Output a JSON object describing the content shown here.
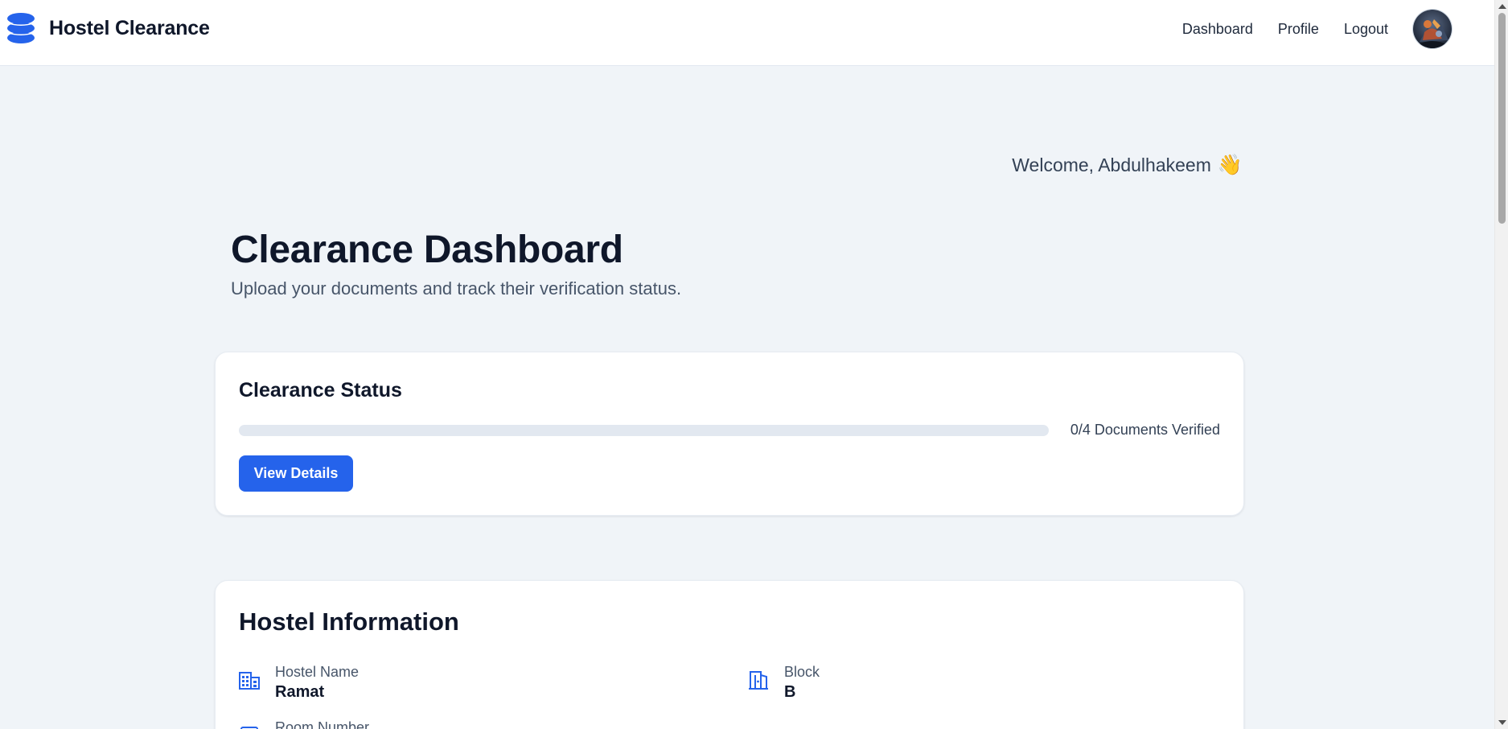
{
  "header": {
    "brand_title": "Hostel Clearance",
    "brand_icon": "stack-icon",
    "nav": {
      "dashboard": "Dashboard",
      "profile": "Profile",
      "logout": "Logout"
    },
    "avatar_icon": "user-avatar"
  },
  "welcome": {
    "text": "Welcome, Abdulhakeem",
    "emoji": "👋"
  },
  "page": {
    "title": "Clearance Dashboard",
    "subtitle": "Upload your documents and track their verification status."
  },
  "clearance_status": {
    "heading": "Clearance Status",
    "progress_fraction": 0,
    "progress_label": "0/4 Documents Verified",
    "view_details_label": "View Details"
  },
  "hostel_info": {
    "heading": "Hostel Information",
    "items": [
      {
        "label": "Hostel Name",
        "value": "Ramat",
        "icon": "building-icon"
      },
      {
        "label": "Block",
        "value": "B",
        "icon": "door-icon"
      },
      {
        "label": "Room Number",
        "value": "",
        "icon": "room-icon"
      }
    ]
  },
  "colors": {
    "primary": "#2563eb",
    "background": "#f0f4f8",
    "card": "#ffffff",
    "text_dark": "#0f172a",
    "text_muted": "#475569"
  }
}
